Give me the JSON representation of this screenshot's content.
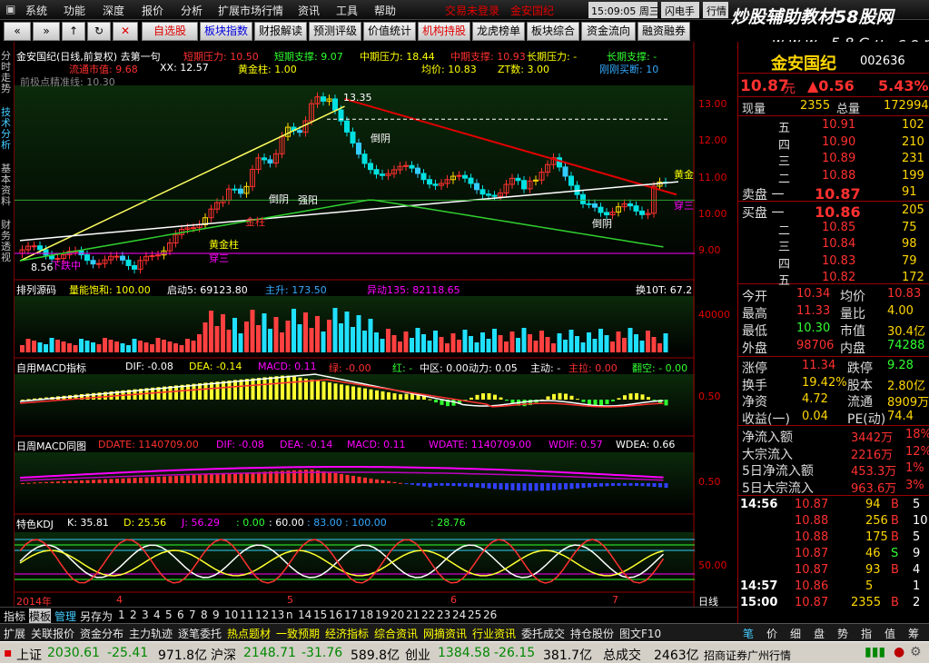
{
  "menubar": {
    "items": [
      "系统",
      "功能",
      "深度",
      "报价",
      "分析",
      "扩展市场行情",
      "资讯",
      "工具",
      "帮助"
    ],
    "trade_link": "交易未登录",
    "stock_link": "金安国纪",
    "clock": "15:09:05 周三",
    "btn_flash": "闪电手",
    "btn_exec": "行情"
  },
  "watermark": {
    "line1": "炒股辅助教材58股网",
    "line2": "w w w . 5 8 G u . c o m"
  },
  "toolbar": {
    "items": [
      {
        "label": "自选股",
        "style": "red"
      },
      {
        "label": "板块指数",
        "style": "blue"
      },
      {
        "label": "财报解读",
        "style": ""
      },
      {
        "label": "预测评级",
        "style": ""
      },
      {
        "label": "价值统计",
        "style": ""
      },
      {
        "label": "机构持股",
        "style": "red"
      },
      {
        "label": "龙虎榜单",
        "style": ""
      },
      {
        "label": "板块综合",
        "style": ""
      },
      {
        "label": "资金流向",
        "style": ""
      },
      {
        "label": "融资融券",
        "style": ""
      }
    ]
  },
  "side_tabs": [
    "分时走势",
    "技术分析",
    "基本资料",
    "财务透视"
  ],
  "main_panel": {
    "title": "金安国纪(日线,前复权) 去第一句",
    "row1": [
      "短期压力: 10.50",
      "短期支撑: 9.07",
      "中期压力: 18.44",
      "中期支撑: 10.93",
      "长期压力: -",
      "长期支撑: -"
    ],
    "row2": [
      "流通市值: 9.68",
      "XX: 12.57",
      "黄金柱: 1.00",
      "均价: 10.83",
      "ZT数: 3.00",
      "刚刚买断: 10"
    ],
    "row3": "前极点精准线: 10.30",
    "labels": {
      "high": "13.35",
      "low": "8.56",
      "annot1": "倒阴",
      "annot2": "倒阴",
      "annot3": "强阳",
      "annot4": "倒阴",
      "annot5": "金柱",
      "annot6": "黄金柱",
      "annot7": "穿三",
      "annot8": "黄金",
      "annot9": "穿三",
      "annot10": "下跌中"
    }
  },
  "vol_panel": {
    "title": "排列源码",
    "items": [
      "量能饱和: 100.00",
      "启动5: 69123.80",
      "主升: 173.50",
      "异动135: 82118.65",
      "换10T: 67.2"
    ],
    "axis": "40000"
  },
  "macd_panel": {
    "title": "自用MACD指标",
    "items": [
      "DIF: -0.08",
      "DEA: -0.14",
      "MACD: 0.11",
      "绿: -0.00",
      "红: -",
      "中区: 0.00",
      "动力: 0.05",
      "主动: -",
      "主拉: 0.00",
      "翻空: - 0.00"
    ],
    "axis": "0.50"
  },
  "week_macd_panel": {
    "title": "日周MACD同图",
    "items": [
      "DDATE: 1140709.00",
      "DIF: -0.08",
      "DEA: -0.14",
      "MACD: 0.11",
      "WDATE: 1140709.00",
      "WDIF: 0.57",
      "WDEA: 0.66"
    ],
    "axis": "0.50"
  },
  "kdj_panel": {
    "title": "特色KDJ",
    "items": [
      "K: 35.81",
      "D: 25.56",
      "J: 56.29",
      ": 0.00",
      ": 60.00",
      ": 83.00",
      ": 100.00",
      ": 28.76"
    ],
    "axis": "50.00"
  },
  "price_axis": [
    "13.00",
    "12.00",
    "11.00",
    "10.00",
    "9.00"
  ],
  "time_axis": {
    "year": "2014年",
    "months": [
      "4",
      "5",
      "6",
      "7"
    ],
    "period": "日线"
  },
  "bottom_tabs": [
    "指标",
    "模板",
    "管理",
    "另存为",
    "1",
    "2",
    "3",
    "4",
    "5",
    "6",
    "7",
    "8",
    "9",
    "10",
    "11",
    "12",
    "13",
    "n",
    "14",
    "15",
    "16",
    "17",
    "18",
    "19",
    "20",
    "21",
    "22",
    "23",
    "24",
    "25",
    "26"
  ],
  "funcbar": [
    {
      "label": "扩展",
      "c": "#e8e8e8"
    },
    {
      "label": "关联报价",
      "c": "#e8e8e8"
    },
    {
      "label": "资金分布",
      "c": "#e8e8e8"
    },
    {
      "label": "主力轨迹",
      "c": "#e8e8e8"
    },
    {
      "label": "逐笔委托",
      "c": "#e8e8e8"
    },
    {
      "label": "热点题材",
      "c": "#ff0"
    },
    {
      "label": "一致预期",
      "c": "#ff0"
    },
    {
      "label": "经济指标",
      "c": "#ff0"
    },
    {
      "label": "综合资讯",
      "c": "#ff0"
    },
    {
      "label": "网摘资讯",
      "c": "#ff0"
    },
    {
      "label": "行业资讯",
      "c": "#ff0"
    },
    {
      "label": "委托成交",
      "c": "#e8e8e8"
    },
    {
      "label": "持仓股份",
      "c": "#e8e8e8"
    },
    {
      "label": "图文F10",
      "c": "#e8e8e8"
    }
  ],
  "quote_tabs": [
    "笔",
    "价",
    "细",
    "盘",
    "势",
    "指",
    "值",
    "筹"
  ],
  "quote": {
    "name": "金安国纪",
    "code": "002636",
    "price": "10.87",
    "unit": "元",
    "change": "▲0.56",
    "pct": "5.43%",
    "cur_label": "现量",
    "cur_val": "2355",
    "total_label": "总量",
    "total_val": "172994",
    "asks": [
      {
        "lvl": "五",
        "p": "10.91",
        "v": "102"
      },
      {
        "lvl": "四",
        "p": "10.90",
        "v": "210"
      },
      {
        "lvl": "三",
        "p": "10.89",
        "v": "231"
      },
      {
        "lvl": "二",
        "p": "10.88",
        "v": "199"
      },
      {
        "lvl": "卖盘 一",
        "p": "10.87",
        "v": "91"
      }
    ],
    "bids": [
      {
        "lvl": "买盘 一",
        "p": "10.86",
        "v": "205"
      },
      {
        "lvl": "二",
        "p": "10.85",
        "v": "75"
      },
      {
        "lvl": "三",
        "p": "10.84",
        "v": "98"
      },
      {
        "lvl": "四",
        "p": "10.83",
        "v": "79"
      },
      {
        "lvl": "五",
        "p": "10.82",
        "v": "172"
      }
    ],
    "stats": [
      [
        "今开",
        "10.34",
        "均价",
        "10.83"
      ],
      [
        "最高",
        "11.33",
        "量比",
        "4.00"
      ],
      [
        "最低",
        "10.30",
        "市值",
        "30.4亿"
      ],
      [
        "外盘",
        "98706",
        "内盘",
        "74288"
      ]
    ],
    "stats2": [
      [
        "涨停",
        "11.34",
        "跌停",
        "9.28"
      ],
      [
        "换手",
        "19.42%",
        "股本",
        "2.80亿"
      ],
      [
        "净资",
        "4.72",
        "流通",
        "8909万"
      ],
      [
        "收益(一)",
        "0.04",
        "PE(动)",
        "74.4"
      ]
    ],
    "flows": [
      [
        "净流入额",
        "3442万",
        "18%"
      ],
      [
        "大宗流入",
        "2216万",
        "12%"
      ],
      [
        "5日净流入额",
        "453.3万",
        "1%"
      ],
      [
        "5日大宗流入",
        "963.6万",
        "3%"
      ]
    ],
    "ticks": [
      [
        "14:56",
        "10.87",
        "94",
        "B",
        "5"
      ],
      [
        "",
        "10.88",
        "256",
        "B",
        "10"
      ],
      [
        "",
        "10.88",
        "175",
        "B",
        "5"
      ],
      [
        "",
        "10.87",
        "46",
        "S",
        "9"
      ],
      [
        "",
        "10.87",
        "93",
        "B",
        "4"
      ],
      [
        "14:57",
        "10.86",
        "5",
        "",
        "1"
      ],
      [
        "15:00",
        "10.87",
        "2355",
        "B",
        "2"
      ]
    ]
  },
  "statusbar": {
    "sh_label": "上证",
    "sh_val": "2030.61",
    "sh_chg": "-25.41",
    "sh_amt": "971.8亿",
    "sz_label": "沪深",
    "sz_val": "2148.71",
    "sz_chg": "-31.76",
    "sz_amt": "589.8亿",
    "cy_label": "创业",
    "cy_val": "1384.58",
    "cy_chg": "-26.15",
    "cy_amt": "381.7亿",
    "total_label": "总成交",
    "total_val": "2463亿",
    "broker": "招商证券广州行情"
  }
}
